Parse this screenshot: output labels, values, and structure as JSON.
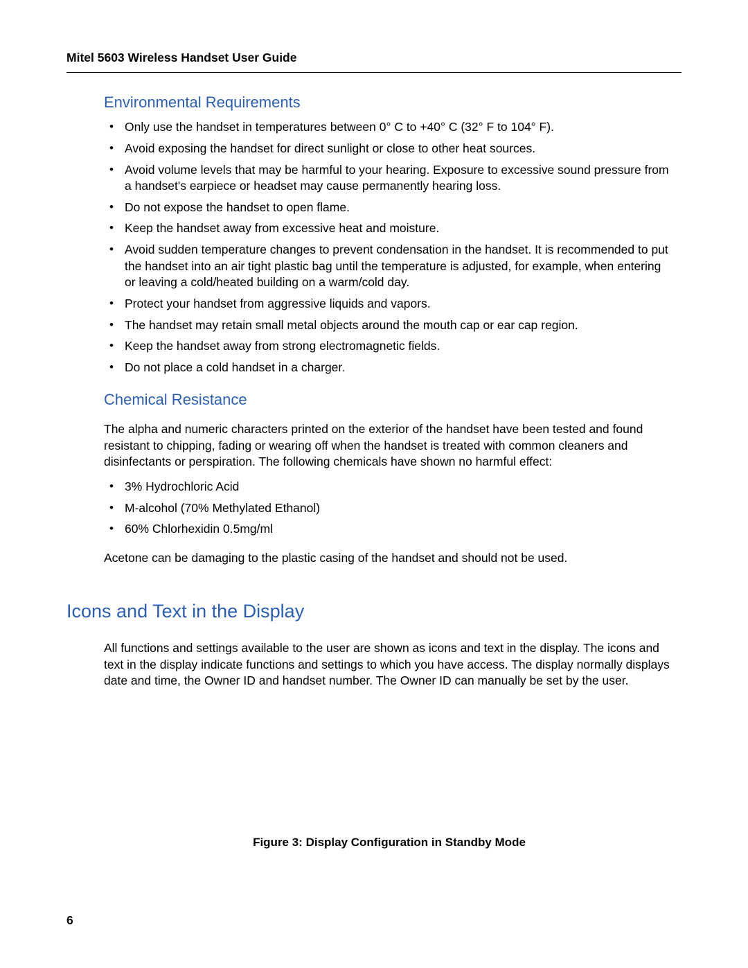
{
  "header": {
    "doc_title": "Mitel 5603 Wireless Handset User Guide"
  },
  "page_number": "6",
  "sections": {
    "env": {
      "heading": "Environmental Requirements",
      "bullets": [
        "Only use the handset in temperatures between 0° C to +40° C (32° F to 104° F).",
        "Avoid exposing the handset for direct sunlight or close to other heat sources.",
        "Avoid volume levels that may be harmful to your hearing. Exposure to excessive sound pressure from a handset's earpiece or headset may cause permanently hearing loss.",
        "Do not expose the handset to open flame.",
        "Keep the handset away from excessive heat and moisture.",
        "Avoid sudden temperature changes to prevent condensation in the handset. It is recommended to put the handset into an air tight plastic bag until the temperature is adjusted, for example, when entering or leaving a cold/heated building on a warm/cold day.",
        "Protect your handset from aggressive liquids and vapors.",
        "The handset may retain small metal objects around the mouth cap or ear cap region.",
        "Keep the handset away from strong electromagnetic fields.",
        "Do not place a cold handset in a charger."
      ]
    },
    "chem": {
      "heading": "Chemical Resistance",
      "intro": "The alpha and numeric characters printed on the exterior of the handset have been tested and found resistant to chipping, fading or wearing off when the handset is treated with common cleaners and disinfectants or perspiration. The following chemicals have shown no harmful effect:",
      "bullets": [
        "3% Hydrochloric Acid",
        "M-alcohol (70% Methylated Ethanol)",
        "60% Chlorhexidin 0.5mg/ml"
      ],
      "acetone_note": "Acetone can be damaging to the plastic casing of the handset and should not be used."
    },
    "icons": {
      "heading": "Icons and Text in the Display",
      "para": "All functions and settings available to the user are shown as icons and text in the display. The icons and text in the display indicate functions and settings to which you have access. The display normally displays date and time, the Owner ID and handset number. The Owner ID can manually be set by the user."
    },
    "figure": {
      "caption": "Figure 3: Display Configuration in Standby Mode"
    }
  }
}
